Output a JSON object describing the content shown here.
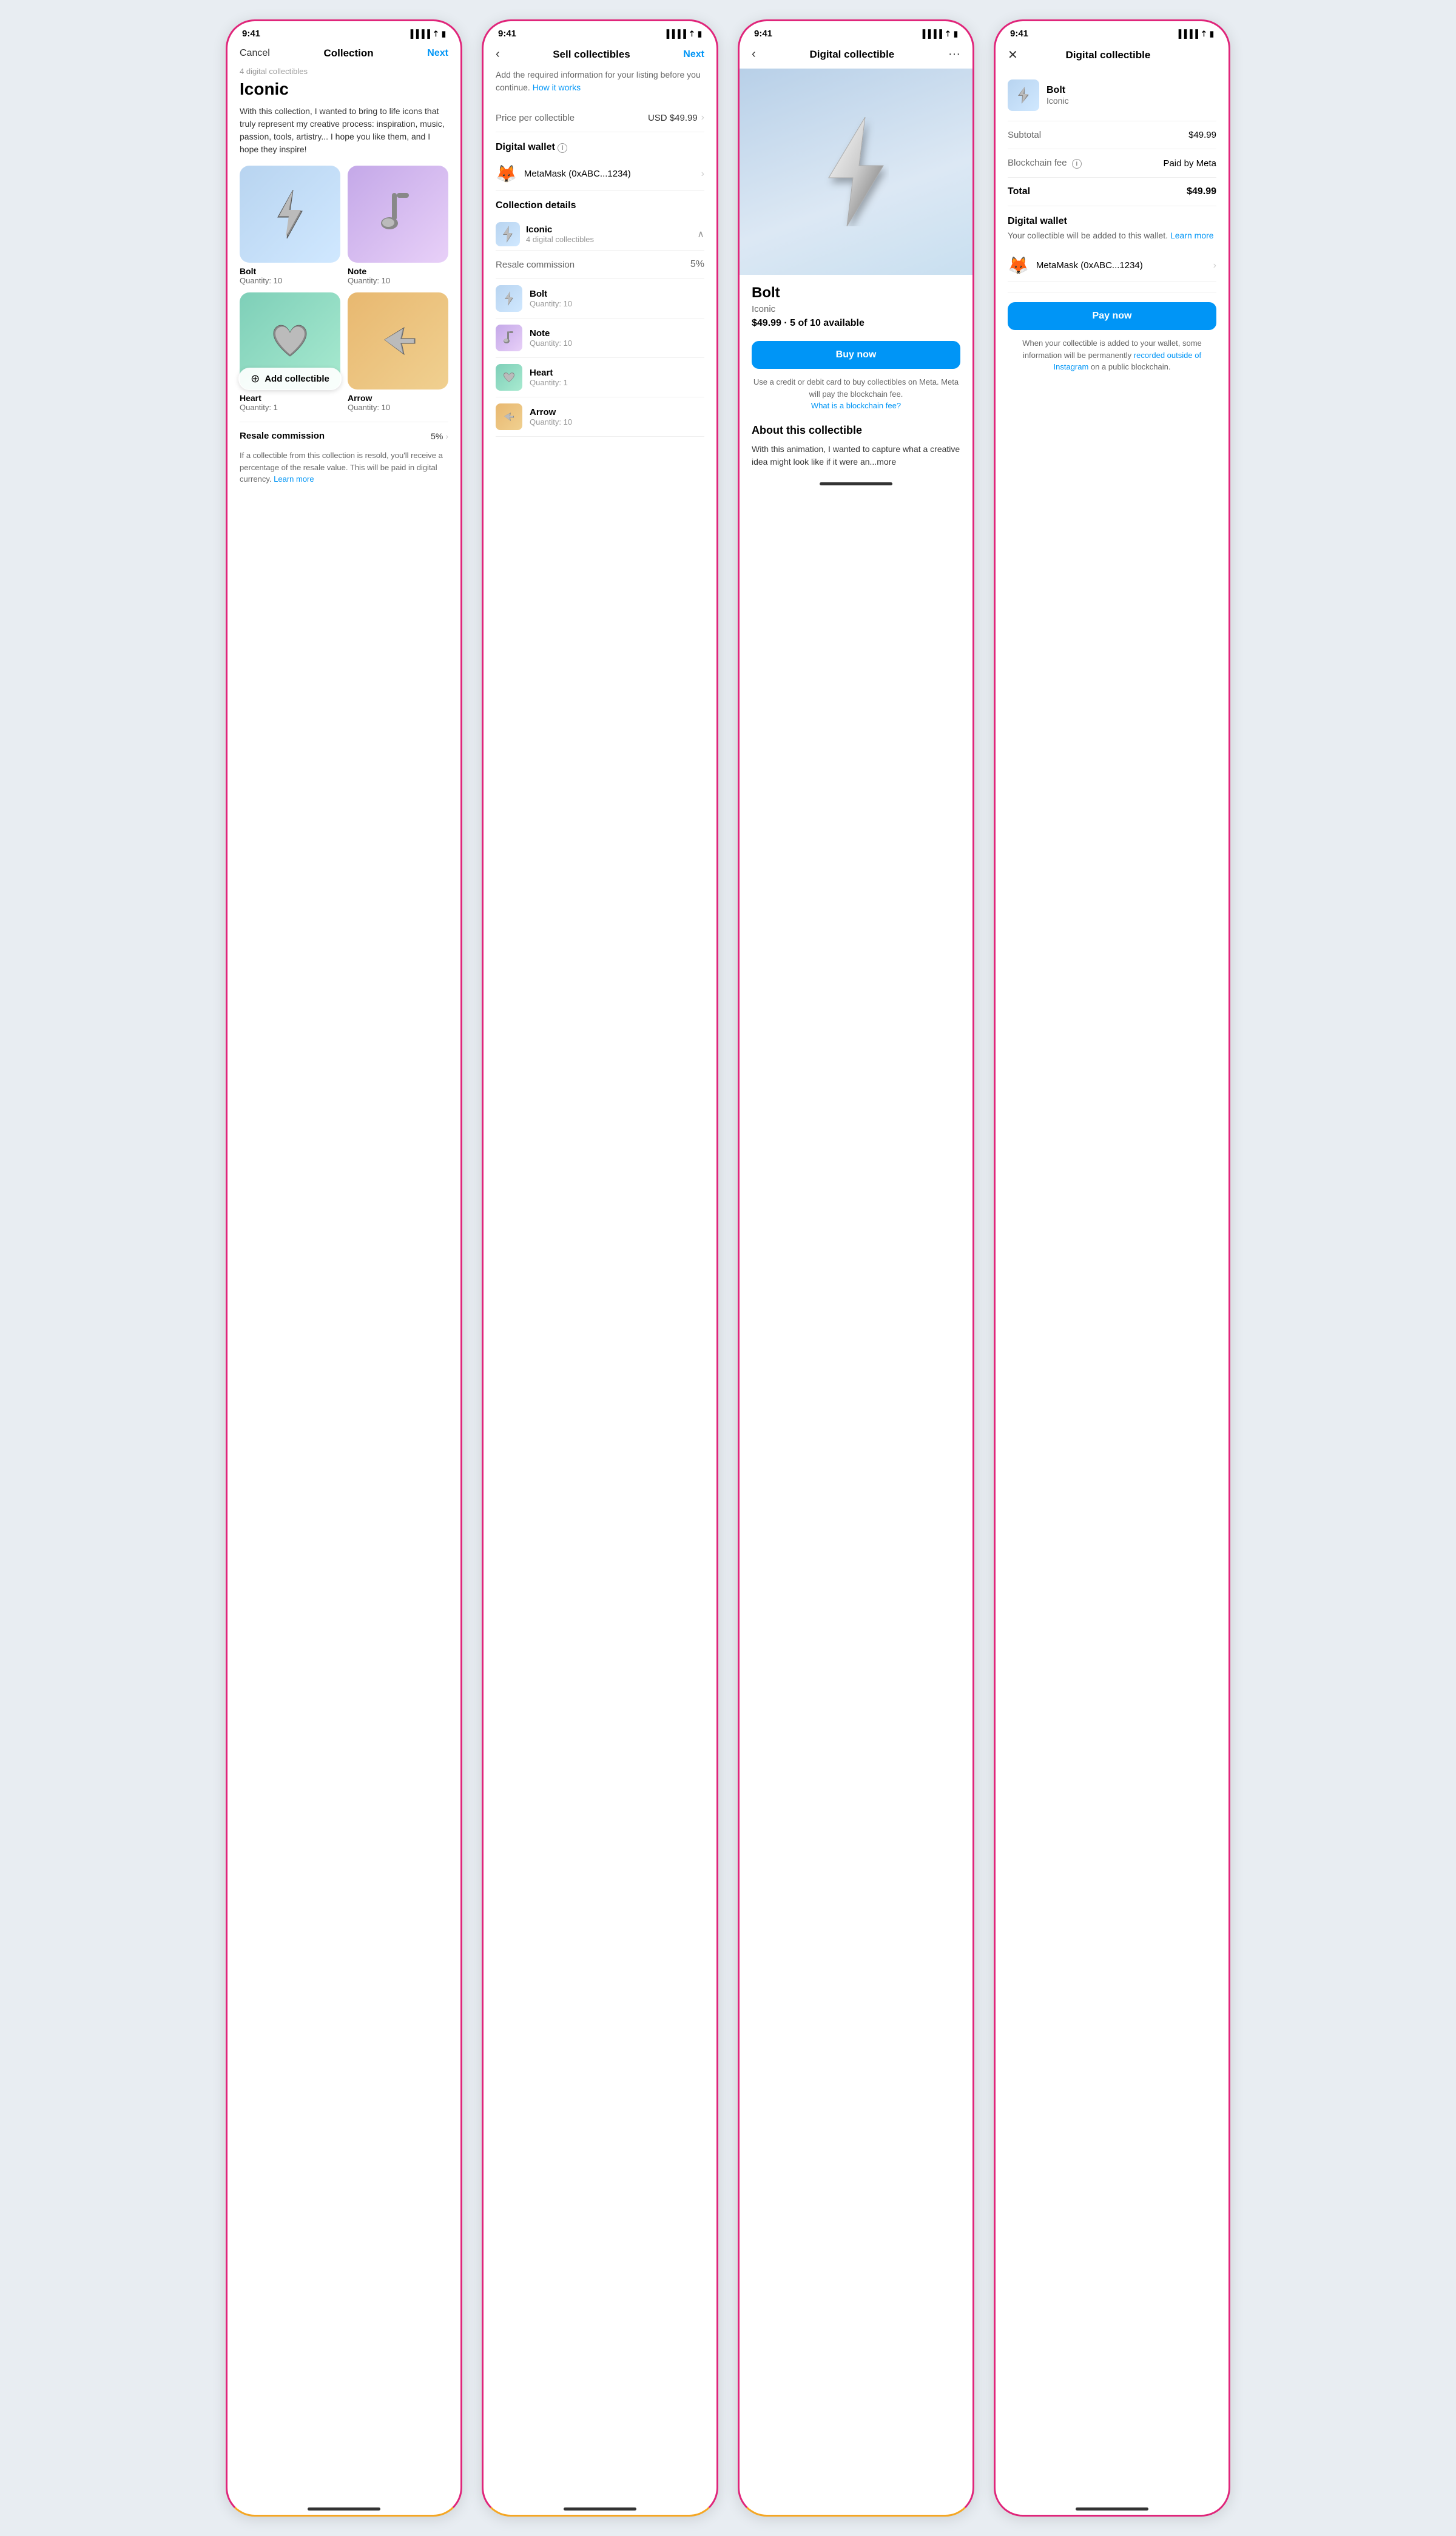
{
  "phone1": {
    "statusBar": {
      "time": "9:41",
      "signal": "●●●●",
      "wifi": "wifi",
      "battery": "battery"
    },
    "nav": {
      "cancel": "Cancel",
      "title": "Collection",
      "next": "Next"
    },
    "meta": "4 digital collectibles",
    "title": "Iconic",
    "description": "With this collection, I wanted to bring to life icons that truly represent my creative process: inspiration, music, passion, tools, artistry... I hope you like them, and I hope they inspire!",
    "collectibles": [
      {
        "name": "Bolt",
        "qty": "Quantity: 10",
        "bg": "bolt",
        "emoji": "⚡"
      },
      {
        "name": "Note",
        "qty": "Quantity: 10",
        "bg": "note",
        "emoji": "🎵"
      },
      {
        "name": "Heart",
        "qty": "Quantity: 1",
        "bg": "heart",
        "emoji": "❤️"
      },
      {
        "name": "Arrow",
        "qty": "Quantity: 10",
        "bg": "arrow",
        "emoji": "➤"
      }
    ],
    "addLabel": "Add collectible",
    "resaleLabel": "Resale commission",
    "resalePct": "5%",
    "resaleNote": "If a collectible from this collection is resold, you'll receive a percentage of the resale value. This will be paid in digital currency.",
    "learnMore": "Learn more"
  },
  "phone2": {
    "statusBar": {
      "time": "9:41"
    },
    "nav": {
      "title": "Sell collectibles",
      "next": "Next"
    },
    "subtitle": "Add the required information for your listing before you continue.",
    "howItWorks": "How it works",
    "priceLabel": "Price per collectible",
    "priceValue": "USD $49.99",
    "walletSection": "Digital wallet",
    "walletName": "MetaMask (0xABC...1234)",
    "collectionSection": "Collection details",
    "collectionName": "Iconic",
    "collectionMeta": "4 digital collectibles",
    "resaleLabel": "Resale commission",
    "resalePct": "5%",
    "collectibles": [
      {
        "name": "Bolt",
        "qty": "Quantity: 10",
        "bg": "blue",
        "emoji": "⚡"
      },
      {
        "name": "Note",
        "qty": "Quantity: 10",
        "bg": "purple",
        "emoji": "🎵"
      },
      {
        "name": "Heart",
        "qty": "Quantity: 1",
        "bg": "teal",
        "emoji": "❤️"
      },
      {
        "name": "Arrow",
        "qty": "Quantity: 10",
        "bg": "orange",
        "emoji": "➤"
      }
    ]
  },
  "phone3": {
    "statusBar": {
      "time": "9:41"
    },
    "nav": {
      "title": "Digital collectible"
    },
    "productTitle": "Bolt",
    "productCollection": "Iconic",
    "productPrice": "$49.99 · 5 of 10 available",
    "buyBtn": "Buy now",
    "buyNote": "Use a credit or debit card to buy collectibles on Meta. Meta will pay the blockchain fee.",
    "blockchainLink": "What is a blockchain fee?",
    "aboutTitle": "About this collectible",
    "aboutText": "With this animation, I wanted to capture what a creative idea might look like if it were an...more"
  },
  "phone4": {
    "statusBar": {
      "time": "9:41"
    },
    "nav": {
      "title": "Digital collectible"
    },
    "collectibleName": "Bolt",
    "collectibleCollection": "Iconic",
    "subtotalLabel": "Subtotal",
    "subtotalValue": "$49.99",
    "blockchainFeeLabel": "Blockchain fee",
    "blockchainFeeValue": "Paid by Meta",
    "totalLabel": "Total",
    "totalValue": "$49.99",
    "walletTitle": "Digital wallet",
    "walletSubtitle": "Your collectible will be added to this wallet.",
    "walletLearnMore": "Learn more",
    "walletName": "MetaMask (0xABC...1234)",
    "payBtn": "Pay now",
    "payNote": "When your collectible is added to your wallet, some information will be permanently",
    "payNoteLink": "recorded outside of Instagram",
    "payNoteEnd": "on a public blockchain."
  }
}
